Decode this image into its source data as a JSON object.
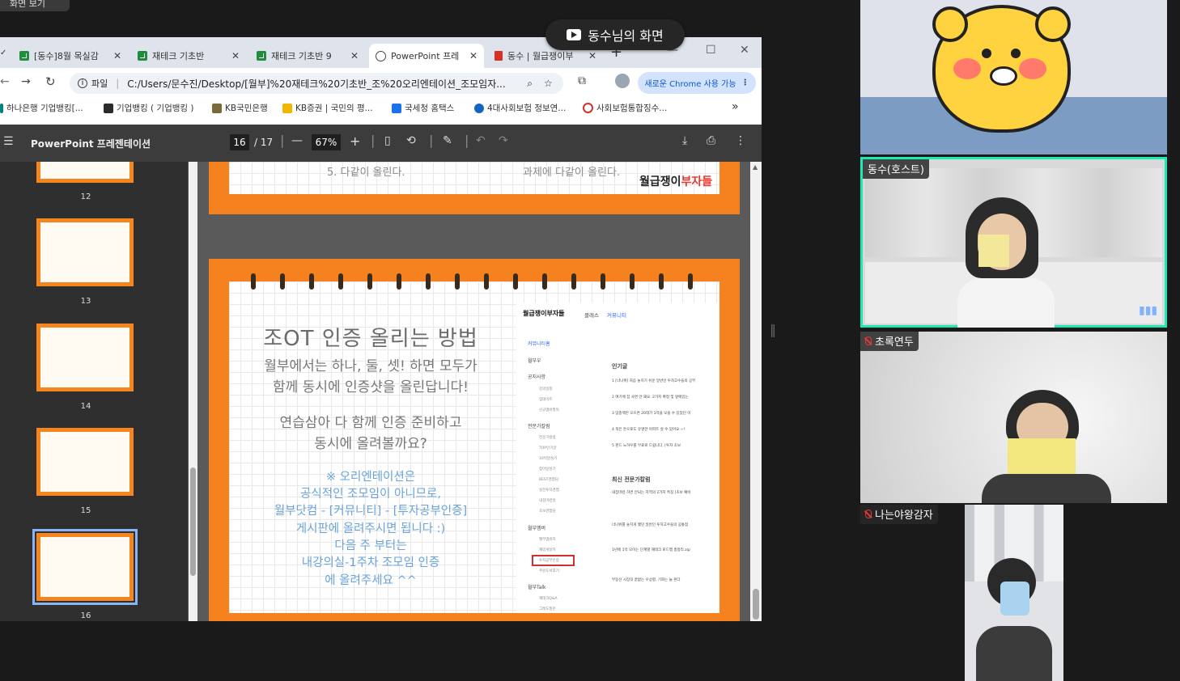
{
  "view_tag": "화면 보기",
  "share_banner": "동수님의 화면",
  "browser": {
    "tabs": [
      {
        "label": "[동수]8월 목실감",
        "icon": "sheets-icon"
      },
      {
        "label": "재테크 기초반",
        "icon": "sheets-icon"
      },
      {
        "label": "재테크 기초반 9",
        "icon": "sheets-icon"
      },
      {
        "label": "PowerPoint 프레",
        "icon": "globe-icon"
      },
      {
        "label": "동수 | 월급쟁이부",
        "icon": "pdf-icon"
      }
    ],
    "new_tab": "+",
    "address": {
      "chip": "파일",
      "url": "C:/Users/문수진/Desktop/[월부]%20재테크%20기초반_조%20오리엔테이션_조모임자..."
    },
    "chrome_badge": "새로운 Chrome 사용 가능",
    "bookmarks": [
      {
        "label": "하나은행 기업뱅킹[...",
        "color": "#00857d"
      },
      {
        "label": "기업뱅킹 ( 기업뱅킹 )",
        "color": "#2b2b2b"
      },
      {
        "label": "KB국민은행",
        "color": "#7a6a3a"
      },
      {
        "label": "KB증권 | 국민의 평...",
        "color": "#f2b600"
      },
      {
        "label": "국세청 홈택스",
        "color": "#1a73e8"
      },
      {
        "label": "4대사회보험 정보연...",
        "color": "#1565c0"
      },
      {
        "label": "사회보험통합징수...",
        "color": "#d32f2f"
      }
    ],
    "bookmarks_more": "»"
  },
  "pdf": {
    "title": "PowerPoint 프레젠테이션",
    "page_current": "16",
    "page_total": "/ 17",
    "zoom": "67%",
    "thumbnails": [
      {
        "num": "12"
      },
      {
        "num": "13"
      },
      {
        "num": "14"
      },
      {
        "num": "15"
      },
      {
        "num": "16"
      }
    ]
  },
  "slide_prev": {
    "text_left": "5. 다같이 올린다.",
    "text_right": "과제에 다같이 올린다.",
    "logo_a": "월급쟁이",
    "logo_b": "부자들"
  },
  "slide": {
    "title": "조OT 인증 올리는 방법",
    "line1": "월부에서는 하나, 둘, 셋! 하면 모두가",
    "line2": "함께 동시에 인증샷을 올린답니다!",
    "line3": "연습삼아 다 함께 인증 준비하고",
    "line4": "동시에 올려볼까요?",
    "note1": "※ 오리엔테이션은",
    "note2": "공식적인 조모임이 아니므로,",
    "note3": "월부닷컴 - [커뮤니티] - [투자공부인증]",
    "note4": "게시판에 올려주시면 됩니다 :)",
    "note5": "다음 주 부터는",
    "note6": "내강의실-1주차 조모임 인증",
    "note7": "에 올려주세요 ^^"
  },
  "screenshot": {
    "brand": "월급쟁이부자들",
    "nav1": "클래스",
    "nav2": "커뮤니티",
    "menu": [
      "커뮤니티홈",
      "월부우",
      "공지사항",
      "강의일정",
      "업데이트",
      "신규멤버필독",
      "전문가칼럼",
      "전문가칼럼",
      "TOP인기글",
      "10억달성기",
      "찾아달성기",
      "BEST경험담",
      "실전투자경험",
      "내집마련일",
      "초보경험담",
      "월부멤버",
      "월부멤버지",
      "재밌게살자",
      "투자공부인증",
      "주린도서후기",
      "월부Talk",
      "재테크Q&A",
      "그래도질문"
    ],
    "hot": "인기글",
    "hot_items": [
      "1 [너나위] 처음 놓치기 쉬운 일반인 투자고수들의 공부",
      "2 여기에 집 사면 안 돼요. 2가지 확정 및 앞에있는",
      "3 맘충백만 모으면 20대가 1억을 모을 수 있었던 이",
      "4 적은 돈으로도 유명한 아파트 살 수 있어요 ~!",
      "5 펀드 노하우를 무료로 드립니다. [투자 초보"
    ],
    "column": "최신 전문가칼럼",
    "col_items": [
      "내집마련 하면 안되는 지역의 2가지 특징 [초보 예비",
      "너나위를 놓치게 했던 일반인 투자고수들의 공통점",
      "1년에 1억 모이는 단계별 재테크 로드맵 총정리.zip",
      "부동산 시장의 끝없는 우상향, 기회는 늘 온다"
    ]
  },
  "participants": [
    {
      "name": "",
      "muted": false
    },
    {
      "name": "동수(호스트)",
      "muted": false,
      "speaking": true
    },
    {
      "name": "초록연두",
      "muted": true
    },
    {
      "name": "나는야왕감자",
      "muted": true
    }
  ],
  "colors": {
    "slide_orange": "#f5821f",
    "speaking_border": "#1de9b6",
    "logo_red": "#e8382e",
    "screenshot_blue": "#2962ff"
  }
}
